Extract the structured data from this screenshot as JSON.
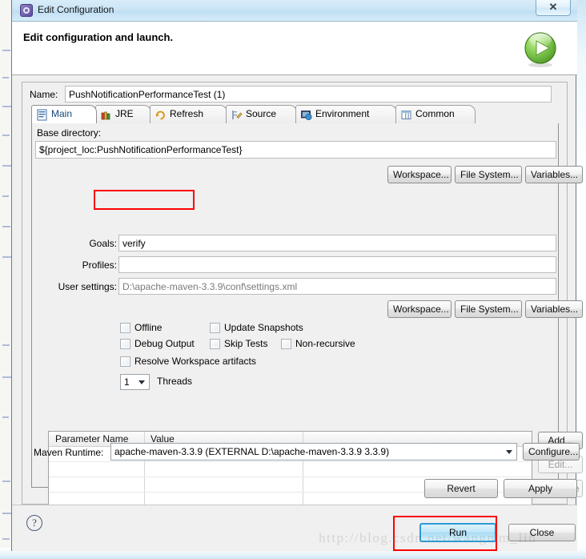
{
  "window": {
    "title": "Edit Configuration",
    "title_icon": "gear-icon",
    "close_glyph": "✕"
  },
  "header": {
    "title": "Edit configuration and launch.",
    "run_badge_icon": "run-play-icon"
  },
  "name_field": {
    "label": "Name:",
    "value": "PushNotificationPerformanceTest (1)"
  },
  "tabs": [
    {
      "label": "Main",
      "icon": "main-form-icon",
      "active": true
    },
    {
      "label": "JRE",
      "icon": "jre-books-icon",
      "active": false
    },
    {
      "label": "Refresh",
      "icon": "refresh-arrows-icon",
      "active": false
    },
    {
      "label": "Source",
      "icon": "source-pencil-icon",
      "active": false
    },
    {
      "label": "Environment",
      "icon": "environment-monitor-icon",
      "active": false
    },
    {
      "label": "Common",
      "icon": "common-table-icon",
      "active": false
    }
  ],
  "main_tab": {
    "base_directory": {
      "label": "Base directory:",
      "value": "${project_loc:PushNotificationPerformanceTest}"
    },
    "base_dir_buttons": [
      {
        "label": "Workspace..."
      },
      {
        "label": "File System..."
      },
      {
        "label": "Variables..."
      }
    ],
    "goals": {
      "label": "Goals:",
      "value": "verify",
      "highlighted": true
    },
    "profiles": {
      "label": "Profiles:",
      "value": ""
    },
    "user_settings": {
      "label": "User settings:",
      "value": "D:\\apache-maven-3.3.9\\conf\\settings.xml"
    },
    "settings_buttons": [
      {
        "label": "Workspace..."
      },
      {
        "label": "File System..."
      },
      {
        "label": "Variables..."
      }
    ],
    "checkboxes": [
      {
        "label": "Offline",
        "checked": false
      },
      {
        "label": "Update Snapshots",
        "checked": false
      },
      {
        "label": "Debug Output",
        "checked": false
      },
      {
        "label": "Skip Tests",
        "checked": false
      },
      {
        "label": "Non-recursive",
        "checked": false
      },
      {
        "label": "Resolve Workspace artifacts",
        "checked": false
      }
    ],
    "threads": {
      "value": "1",
      "label": "Threads"
    },
    "parameter_table": {
      "columns": [
        "Parameter Name",
        "Value",
        ""
      ],
      "rows": []
    },
    "table_buttons": [
      {
        "label": "Add...",
        "enabled": true
      },
      {
        "label": "Edit...",
        "enabled": false
      },
      {
        "label": "Remove",
        "enabled": false
      }
    ],
    "maven_runtime": {
      "label": "Maven Runtime:",
      "value": "apache-maven-3.3.9 (EXTERNAL D:\\apache-maven-3.3.9 3.3.9)",
      "configure_label": "Configure..."
    }
  },
  "form_buttons": {
    "revert": "Revert",
    "apply": "Apply"
  },
  "dialog_buttons": {
    "help": "?",
    "run": "Run",
    "close": "Close"
  },
  "watermark": "http://blog.csdn.net/wangmm_lin",
  "colors": {
    "accent_blue": "#2e9bd6",
    "annotation_red": "#ff0000",
    "title_bar": "#cbe5f6",
    "dialog_bg": "#f0f0f0",
    "run_green": "#5aa832"
  }
}
